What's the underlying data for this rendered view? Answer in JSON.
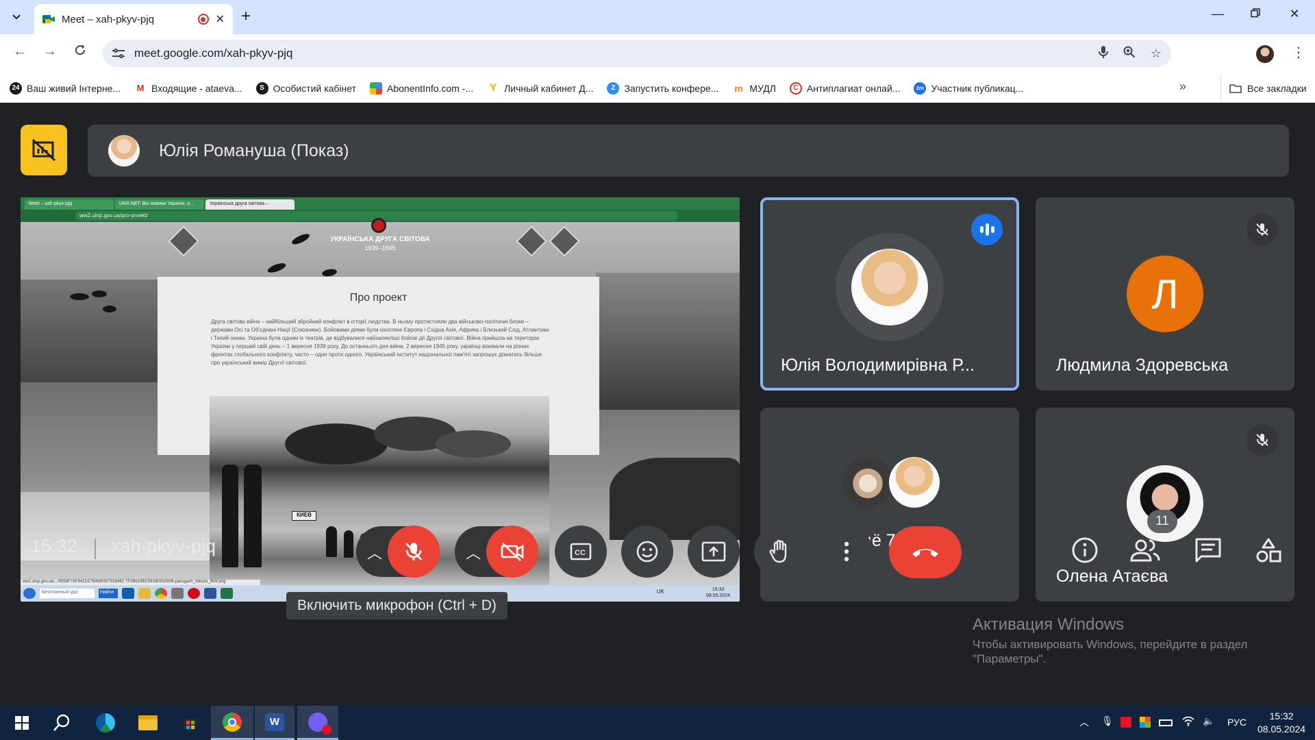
{
  "browser": {
    "tab_title": "Meet – xah-pkyv-pjq",
    "url": "meet.google.com/xah-pkyv-pjq",
    "new_tab_symbol": "+",
    "bookmarks": [
      {
        "label": "Ваш живий Інтерне...",
        "color": "#1a1a1a",
        "glyph": "24"
      },
      {
        "label": "Входящие - ataeva...",
        "color": "#ffffff",
        "glyph": "M"
      },
      {
        "label": "Особистий кабінет",
        "color": "#1a1a1a",
        "glyph": "S"
      },
      {
        "label": "AbonentInfo.com -...",
        "color": "#4285f4",
        "glyph": "A"
      },
      {
        "label": "Личный кабинет Д...",
        "color": "#fbbc04",
        "glyph": "Y"
      },
      {
        "label": "Запустить конфере...",
        "color": "#2d8cff",
        "glyph": "Z"
      },
      {
        "label": "МУДЛ",
        "color": "#f98012",
        "glyph": "m"
      },
      {
        "label": "Антиплагиат онлай...",
        "color": "#d93025",
        "glyph": "C"
      },
      {
        "label": "Участник публикац...",
        "color": "#1a73e8",
        "glyph": "zm"
      }
    ],
    "all_bookmarks": "Все закладки"
  },
  "meet": {
    "presenter_label": "Юлія Романуша (Показ)",
    "tooltip": "Включить микрофон (Ctrl + D)",
    "time": "15:32",
    "meeting_code": "xah-pkyv-pjq",
    "participants_count": "11",
    "tiles": [
      {
        "name": "Юлія Володимирівна Р...",
        "state": "speaking"
      },
      {
        "name": "Людмила Здоревська",
        "initial": "Л",
        "state": "muted"
      },
      {
        "name": "Ещё 7 чел."
      },
      {
        "name": "Олена Атаєва",
        "state": "muted"
      }
    ],
    "activation": {
      "title": "Активация Windows",
      "text": "Чтобы активировать Windows, перейдите в раздел \"Параметры\"."
    }
  },
  "shared_screen": {
    "tabs": [
      "Meet – xah-pkyv-pjq",
      "UKR.NET: Всі новини України, о...",
      "Українська друга світова –"
    ],
    "url": "ww2.uinp.gov.ua/pro-proekt/",
    "logo_title": "УКРАЇНСЬКА ДРУГА СВІТОВА",
    "logo_years": "1939–1945",
    "card_title": "Про проект",
    "card_text": "Друга світова війна – найбільший збройний конфлікт в історії людства. В ньому протистояли два військово-політичні блоки – держави Осі та Об'єднані Нації (Союзники). Бойовими діями були охоплені Європа і Східна Азія, Африка і Близький Схід, Атлантика і Тихий океан. Україна була одним із театрів, де відбувалися найзапекліші бойові дії Другої світової. Війна прийшла на територію України у перший свій день – 1 вересня 1939 року. До останнього дня війни, 2 вересня 1945 року, українці воювали на різних фронтах глобального конфлікту, часто – один проти одного. Український інститут національної пам'яті запрошує дізнатись більше про український вимір Другої світової.",
    "sign": "КИЕВ",
    "status_url": "ww2.uinp.gov.ua/.../0056F7AF941D1760680307918462 7F2B619BC5918D910808-panogash_fullsize_distr.png",
    "search_placeholder": "Бесплатный уро",
    "search_button": "Найти",
    "lang": "UK",
    "clock_time": "15:33",
    "clock_date": "08.05.2024"
  },
  "taskbar": {
    "lang": "РУС",
    "time": "15:32",
    "date": "08.05.2024"
  }
}
